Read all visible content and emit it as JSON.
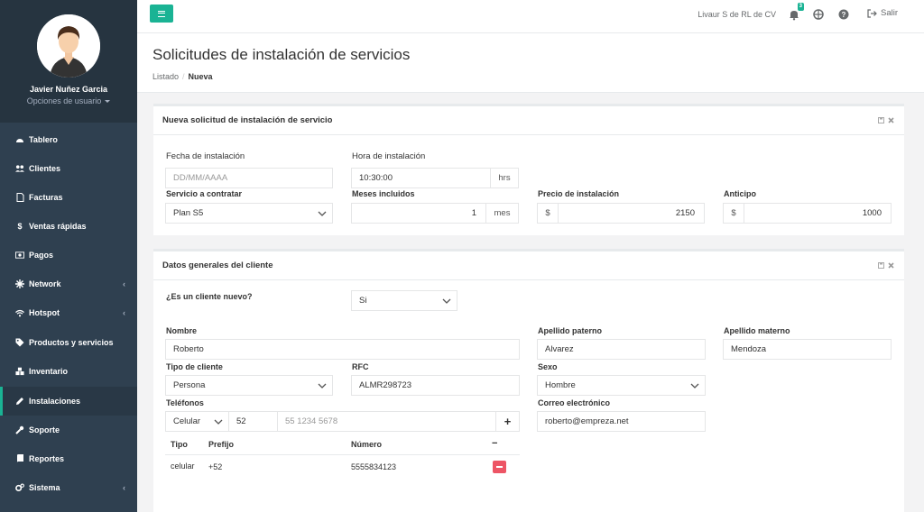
{
  "user": {
    "name": "Javier Nuñez Garcia",
    "options": "Opciones de usuario"
  },
  "sidebar": {
    "items": [
      {
        "label": "Tablero"
      },
      {
        "label": "Clientes"
      },
      {
        "label": "Facturas"
      },
      {
        "label": "Ventas rápidas"
      },
      {
        "label": "Pagos"
      },
      {
        "label": "Network"
      },
      {
        "label": "Hotspot"
      },
      {
        "label": "Productos y servicios"
      },
      {
        "label": "Inventario"
      },
      {
        "label": "Instalaciones"
      },
      {
        "label": "Soporte"
      },
      {
        "label": "Reportes"
      },
      {
        "label": "Sistema"
      }
    ]
  },
  "topbar": {
    "company": "Livaur S de RL de CV",
    "notifications": "3",
    "logout": "Salir"
  },
  "page": {
    "title": "Solicitudes de instalación de servicios",
    "crumb_1": "Listado",
    "crumb_sep": "/",
    "crumb_2": "Nueva"
  },
  "panel1": {
    "title": "Nueva solicitud de instalación de servicio",
    "fecha_label": "Fecha de instalación",
    "fecha_placeholder": "DD/MM/AAAA",
    "hora_label": "Hora de instalación",
    "hora_value": "10:30:00",
    "hora_unit": "hrs",
    "servicio_label": "Servicio a contratar",
    "servicio_value": "Plan S5",
    "meses_label": "Meses incluidos",
    "meses_value": "1",
    "meses_unit": "mes",
    "precio_label": "Precio de instalación",
    "precio_prefix": "$",
    "precio_value": "2150",
    "anticipo_label": "Anticipo",
    "anticipo_prefix": "$",
    "anticipo_value": "1000"
  },
  "panel2": {
    "title": "Datos generales del cliente",
    "nuevo_label": "¿Es un cliente nuevo?",
    "nuevo_value": "Si",
    "nombre_label": "Nombre",
    "nombre_value": "Roberto",
    "paterno_label": "Apellido paterno",
    "paterno_value": "Alvarez",
    "materno_label": "Apellido materno",
    "materno_value": "Mendoza",
    "tipo_label": "Tipo de cliente",
    "tipo_value": "Persona",
    "rfc_label": "RFC",
    "rfc_value": "ALMR298723",
    "sexo_label": "Sexo",
    "sexo_value": "Hombre",
    "telefonos_label": "Teléfonos",
    "tel_tipo_value": "Celular",
    "tel_prefijo_value": "52",
    "tel_numero_placeholder": "55 1234 5678",
    "tel_add": "+",
    "correo_label": "Correo electrónico",
    "correo_value": "roberto@empreza.net",
    "table": {
      "headers": {
        "tipo": "Tipo",
        "prefijo": "Prefijo",
        "numero": "Número",
        "action": "−"
      },
      "rows": [
        {
          "tipo": "celular",
          "prefijo": "+52",
          "numero": "5555834123"
        }
      ]
    }
  }
}
